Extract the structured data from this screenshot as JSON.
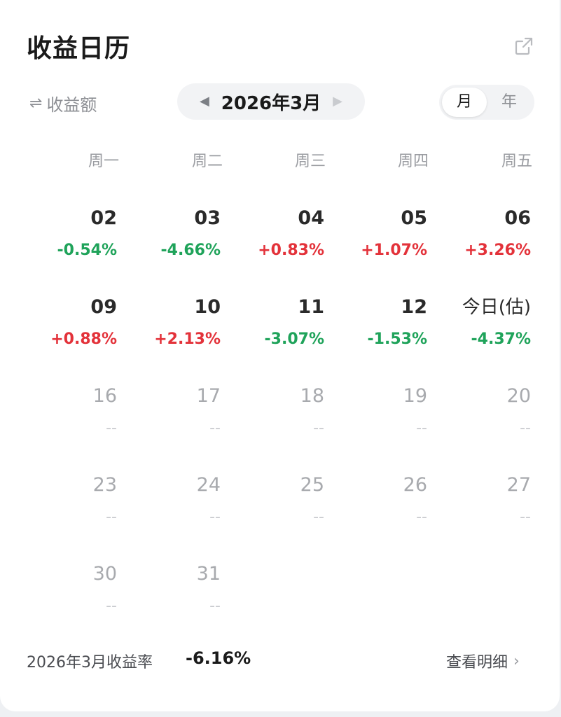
{
  "header": {
    "title": "收益日历",
    "share_icon": "external-link-icon"
  },
  "controls": {
    "metric_toggle_icon": "⇌",
    "metric_toggle_label": "收益额",
    "month_label": "2026年3月",
    "prev_icon": "◀",
    "next_icon": "▶",
    "period_options": [
      "月",
      "年"
    ],
    "period_selected": "月"
  },
  "weekdays": [
    "周一",
    "周二",
    "周三",
    "周四",
    "周五"
  ],
  "days": [
    {
      "day": "02",
      "pct": "-0.54%",
      "trend": "down"
    },
    {
      "day": "03",
      "pct": "-4.66%",
      "trend": "down"
    },
    {
      "day": "04",
      "pct": "+0.83%",
      "trend": "up"
    },
    {
      "day": "05",
      "pct": "+1.07%",
      "trend": "up"
    },
    {
      "day": "06",
      "pct": "+3.26%",
      "trend": "up"
    },
    {
      "day": "09",
      "pct": "+0.88%",
      "trend": "up"
    },
    {
      "day": "10",
      "pct": "+2.13%",
      "trend": "up"
    },
    {
      "day": "11",
      "pct": "-3.07%",
      "trend": "down"
    },
    {
      "day": "12",
      "pct": "-1.53%",
      "trend": "down"
    },
    {
      "day": "今日(估)",
      "pct": "-4.37%",
      "trend": "down",
      "today": true
    },
    {
      "day": "16",
      "pct": "--",
      "trend": "none"
    },
    {
      "day": "17",
      "pct": "--",
      "trend": "none"
    },
    {
      "day": "18",
      "pct": "--",
      "trend": "none"
    },
    {
      "day": "19",
      "pct": "--",
      "trend": "none"
    },
    {
      "day": "20",
      "pct": "--",
      "trend": "none"
    },
    {
      "day": "23",
      "pct": "--",
      "trend": "none"
    },
    {
      "day": "24",
      "pct": "--",
      "trend": "none"
    },
    {
      "day": "25",
      "pct": "--",
      "trend": "none"
    },
    {
      "day": "26",
      "pct": "--",
      "trend": "none"
    },
    {
      "day": "27",
      "pct": "--",
      "trend": "none"
    },
    {
      "day": "30",
      "pct": "--",
      "trend": "none"
    },
    {
      "day": "31",
      "pct": "--",
      "trend": "none"
    }
  ],
  "colors": {
    "up": "#e3323a",
    "down": "#1fa35a"
  },
  "footer": {
    "summary_label": "2026年3月收益率",
    "summary_value": "-6.16%",
    "details_label": "查看明细",
    "details_icon": "chevron-right-icon"
  }
}
